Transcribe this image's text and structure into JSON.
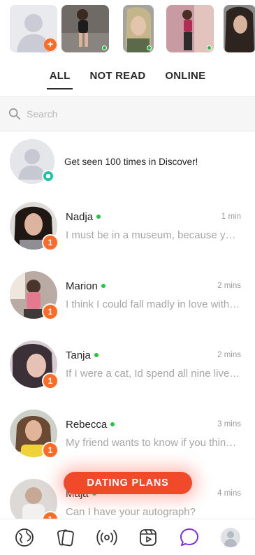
{
  "stories": {
    "self": {
      "add_symbol": "+"
    },
    "items": [
      {
        "online": true
      },
      {
        "online": true
      },
      {
        "online": true
      },
      {
        "online": false
      }
    ]
  },
  "tabs": [
    {
      "label": "ALL",
      "active": true
    },
    {
      "label": "NOT READ",
      "active": false
    },
    {
      "label": "ONLINE",
      "active": false
    }
  ],
  "search": {
    "placeholder": "Search",
    "icon": "search-icon"
  },
  "promo": {
    "text": "Get seen 100 times in Discover!"
  },
  "conversations": [
    {
      "name": "Nadja",
      "time": "1 min",
      "message": "I must be in a museum, because you truly are a work of art.",
      "unread": "1",
      "online": true
    },
    {
      "name": "Marion",
      "time": "2 mins",
      "message": "I think I could fall madly in love with you.",
      "unread": "1",
      "online": true
    },
    {
      "name": "Tanja",
      "time": "2 mins",
      "message": "If I were a cat, Id spend all nine lives with you.",
      "unread": "1",
      "online": true
    },
    {
      "name": "Rebecca",
      "time": "3 mins",
      "message": "My friend wants to know if you think I'm cute.",
      "unread": "1",
      "online": true
    },
    {
      "name": "Maja",
      "time": "4 mins",
      "message": "Can I have your autograph?",
      "unread": "1",
      "online": true
    }
  ],
  "dating_plans": {
    "label": "DATING PLANS"
  },
  "nav": {
    "items": [
      "globe-icon",
      "cards-icon",
      "broadcast-icon",
      "reels-icon",
      "chat-icon",
      "profile-avatar"
    ],
    "active_color": "#7b2fe0",
    "inactive_color": "#333333"
  },
  "colors": {
    "accent": "#ff6a24",
    "online": "#1fc83f",
    "dating": "#f14a2b"
  }
}
